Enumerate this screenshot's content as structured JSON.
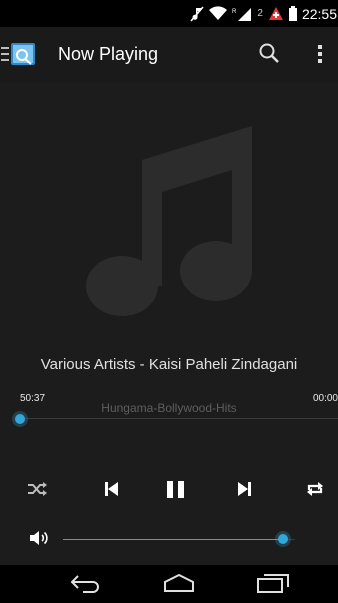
{
  "status_bar": {
    "time": "22:55",
    "notification_count": "2",
    "icons": [
      "moon-icon",
      "mute-icon",
      "wifi-icon",
      "signal-icon",
      "alert-icon",
      "battery-icon"
    ]
  },
  "action_bar": {
    "title": "Now Playing",
    "icons": [
      "drawer-icon",
      "app-logo-icon",
      "search-icon",
      "overflow-menu-icon"
    ]
  },
  "player": {
    "track": "Various Artists - Kaisi Paheli Zindagani",
    "album": "Hungama-Bollywood-Hits",
    "elapsed": "50:37",
    "total": "00:00",
    "seek_progress": 0.0,
    "volume_level": 0.95,
    "controls": [
      "shuffle-icon",
      "previous-icon",
      "pause-icon",
      "next-icon",
      "repeat-icon"
    ]
  },
  "colors": {
    "accent": "#33a6d8",
    "background": "#1c1c1c",
    "action_bar": "#1a1a1a",
    "album_text": "#5e5e5e",
    "notification_red": "#e53935"
  },
  "nav_bar": {
    "icons": [
      "back-icon",
      "home-icon",
      "recents-icon"
    ]
  }
}
